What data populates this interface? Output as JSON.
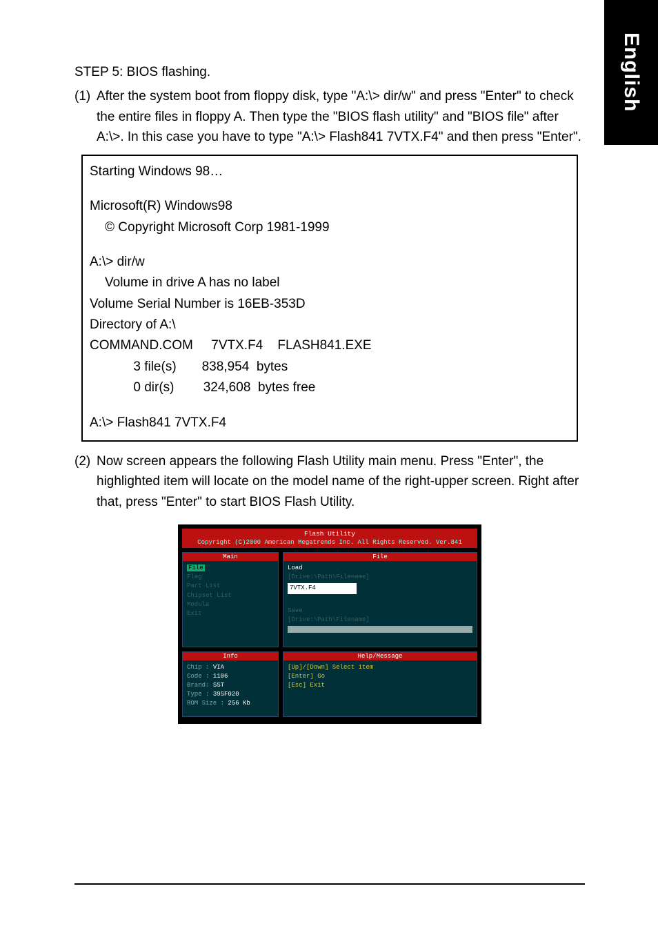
{
  "sideTab": "English",
  "step": "STEP 5: BIOS flashing.",
  "p1_num": "(1)",
  "p1_text": "After the system boot from floppy disk, type \"A:\\> dir/w\" and press \"Enter\" to check the entire files in floppy A.  Then type the \"BIOS flash utility\" and \"BIOS file\" after A:\\>.  In this case you have to type \"A:\\> Flash841 7VTX.F4\" and then press \"Enter\".",
  "dos": {
    "l1": "Starting Windows 98…",
    "l2": "Microsoft(R) Windows98",
    "l3": "© Copyright Microsoft Corp 1981-1999",
    "l4": "A:\\> dir/w",
    "l5": "Volume in drive A has no label",
    "l6": "Volume Serial Number is 16EB-353D",
    "l7": "Directory of A:\\",
    "l8": "COMMAND.COM     7VTX.F4    FLASH841.EXE",
    "l9": "3 file(s)       838,954  bytes",
    "l10": "0 dir(s)        324,608  bytes free",
    "l11": "A:\\> Flash841 7VTX.F4"
  },
  "p2_num": "(2)",
  "p2_text": "Now screen appears the following Flash Utility main menu. Press \"Enter\", the highlighted item will locate on the model name of the right-upper screen. Right after that, press \"Enter\" to start BIOS Flash Utility.",
  "flash": {
    "title": "Flash Utility",
    "copyright": "Copyright (C)2000 American Megatrends Inc. All Rights Reserved. Ver.841",
    "mainHead": "Main",
    "fileHead": "File",
    "menu": {
      "m1": "File",
      "m2": "Flag",
      "m3": "Part List",
      "m4": "Chipset List",
      "m5": "Module",
      "m6": "Exit"
    },
    "loadLabel": "Load",
    "loadHint": "[Drive:\\Path\\Filename]",
    "loadValue": "7VTX.F4",
    "saveLabel": "Save",
    "saveHint": "[Drive:\\Path\\Filename]",
    "infoHead": "Info",
    "helpHead": "Help/Message",
    "info": {
      "chipL": "Chip :",
      "chipV": "VIA",
      "codeL": "Code :",
      "codeV": "1106",
      "brandL": "Brand:",
      "brandV": "SST",
      "typeL": "Type :",
      "typeV": "39SF020",
      "romL": "ROM Size :",
      "romV": "256 Kb"
    },
    "help": {
      "h1": "[Up]/[Down] Select item",
      "h2": "[Enter] Go",
      "h3": "[Esc] Exit"
    }
  }
}
